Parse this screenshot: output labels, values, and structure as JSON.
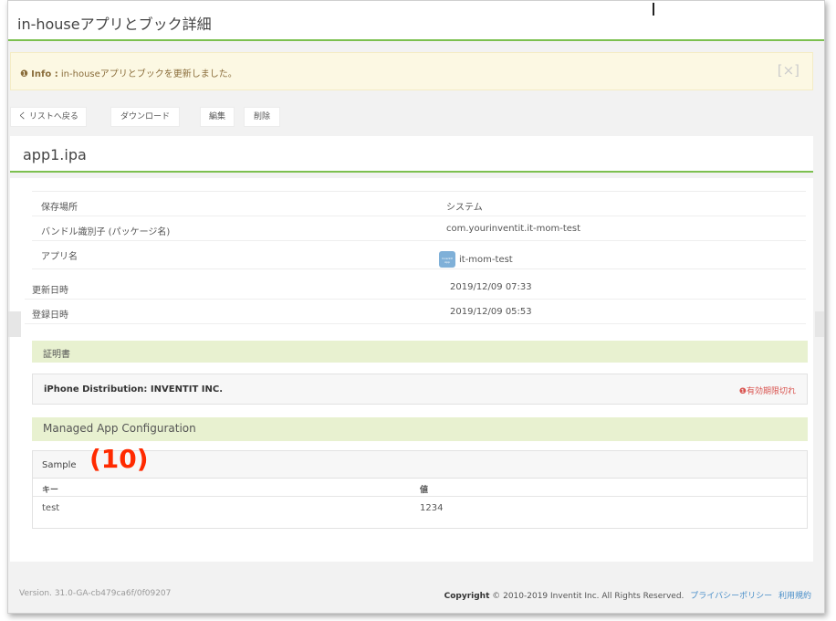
{
  "header": {
    "title": "in-houseアプリとブック詳細"
  },
  "alert": {
    "label": "Info :",
    "message": " in-houseアプリとブックを更新しました。",
    "close": "[×]"
  },
  "toolbar": {
    "back": "く リストへ戻る",
    "download": "ダウンロード",
    "edit": "編集",
    "delete": "削除"
  },
  "file": {
    "name": "app1.ipa"
  },
  "details": [
    {
      "key": "保存場所",
      "value": "システム"
    },
    {
      "key": "バンドル識別子 (パッケージ名)",
      "value": "com.yourinventit.it-mom-test"
    },
    {
      "key": "アプリ名",
      "value": "it-mom-test"
    }
  ],
  "app_icon_text": "Inventit App",
  "dates": [
    {
      "key": "更新日時",
      "value": "2019/12/09 07:33"
    },
    {
      "key": "登録日時",
      "value": "2019/12/09 05:53"
    }
  ],
  "certificate": {
    "section": "証明書",
    "name": "iPhone Distribution: INVENTIT INC.",
    "status": "有効期限切れ"
  },
  "config": {
    "section": "Managed App Configuration",
    "name": "Sample",
    "annotation": "(10)",
    "key_header": "キー",
    "value_header": "値",
    "rows": [
      {
        "key": "test",
        "value": "1234"
      }
    ]
  },
  "footer": {
    "version": "Version. 31.0-GA-cb479ca6f/0f09207",
    "copyright_label": "Copyright",
    "copyright_text": " © 2010-2019 Inventit Inc. All Rights Reserved.",
    "privacy": "プライバシーポリシー",
    "terms": "利用規約"
  },
  "colors": {
    "accent": "#7cc04f",
    "alert_bg": "#fcf8e3",
    "section_bg": "#e8f1d0",
    "danger": "#d9534f",
    "link": "#4a8fc9",
    "annotation": "#ff2a00"
  }
}
